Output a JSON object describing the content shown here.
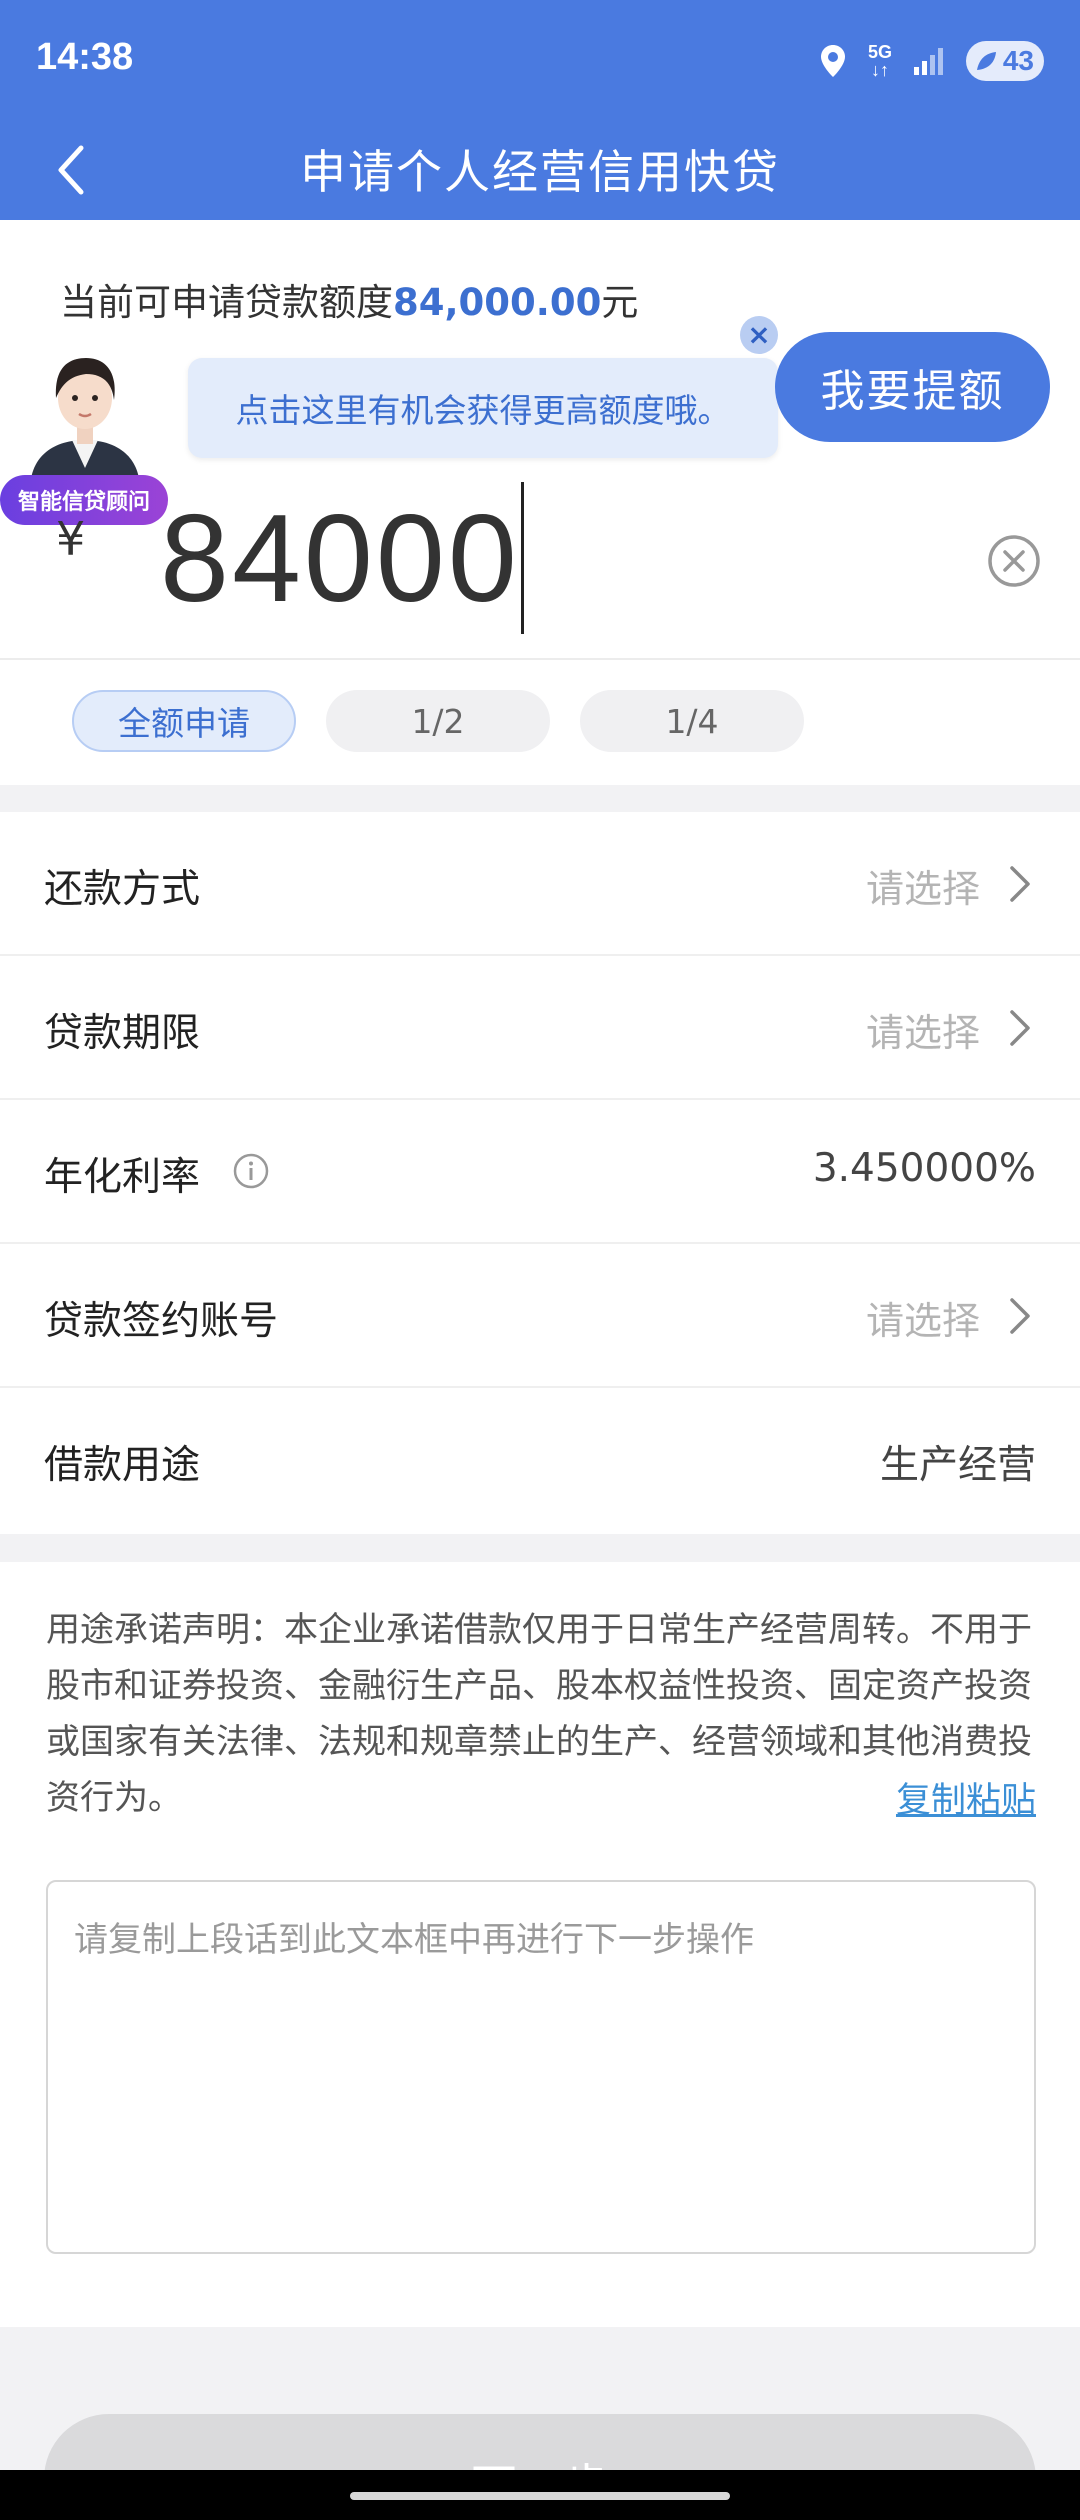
{
  "status_bar": {
    "time": "14:38",
    "network_top": "5G",
    "network_bottom": "↓↑",
    "battery": "43",
    "icons": [
      "location-icon",
      "signal-icon",
      "battery-icon"
    ]
  },
  "nav": {
    "title": "申请个人经营信用快贷",
    "back_icon": "chevron-left-icon"
  },
  "quota": {
    "prefix": "当前可申请贷款额度",
    "amount": "84,000.00",
    "suffix": "元"
  },
  "advisor": {
    "badge": "智能信贷顾问",
    "tip": "点击这里有机会获得更高额度哦。",
    "tip_close": "×",
    "raise_button": "我要提额"
  },
  "amount_input": {
    "currency": "¥",
    "value": "84000"
  },
  "quick_amounts": [
    {
      "label": "全额申请",
      "active": true
    },
    {
      "label": "1/2",
      "active": false
    },
    {
      "label": "1/4",
      "active": false
    }
  ],
  "form": {
    "repayment": {
      "label": "还款方式",
      "placeholder": "请选择"
    },
    "term": {
      "label": "贷款期限",
      "placeholder": "请选择"
    },
    "rate": {
      "label": "年化利率",
      "value": "3.450000%"
    },
    "account": {
      "label": "贷款签约账号",
      "placeholder": "请选择"
    },
    "purpose": {
      "label": "借款用途",
      "value": "生产经营"
    }
  },
  "statement": {
    "text": "用途承诺声明：本企业承诺借款仅用于日常生产经营周转。不用于股市和证券投资、金融衍生产品、股本权益性投资、固定资产投资或国家有关法律、法规和规章禁止的生产、经营领域和其他消费投资行为。",
    "copy_link": "复制粘贴",
    "textarea_placeholder": "请复制上段话到此文本框中再进行下一步操作"
  },
  "next_button": "下一步",
  "colors": {
    "primary": "#4a7ae0",
    "accent_text": "#3c6fd0",
    "link": "#3b8fd6",
    "disabled_button": "#dadadc"
  }
}
